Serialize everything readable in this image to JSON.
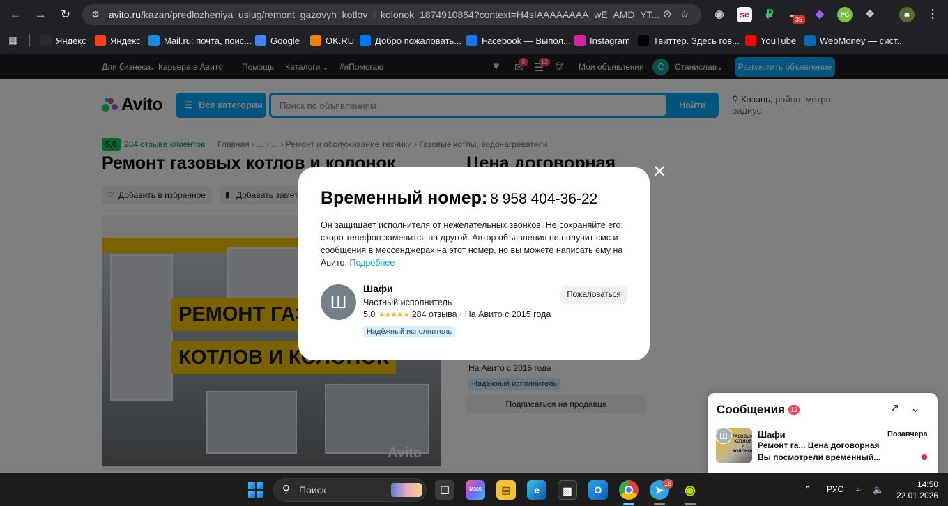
{
  "browser": {
    "url_host": "avito.ru",
    "url_path": "/kazan/predlozheniya_uslug/remont_gazovyh_kotlov_i_kolonok_1874910854?context=H4sIAAAAAAAA_wE_AMD_YT...",
    "extension_badge": "35",
    "bookmarks": [
      {
        "label": "Яндекс",
        "icon": "yandex-star-icon",
        "color": "#2b2b2b"
      },
      {
        "label": "Яндекс",
        "icon": "yandex-icon",
        "color": "#fc3f1d"
      },
      {
        "label": "Mail.ru: почта, поис...",
        "icon": "mailru-icon",
        "color": "#168de2"
      },
      {
        "label": "Google",
        "icon": "google-icon",
        "color": "#4285f4"
      },
      {
        "label": "OK.RU",
        "icon": "ok-icon",
        "color": "#ee8208"
      },
      {
        "label": "Добро пожаловать...",
        "icon": "vk-icon",
        "color": "#0077ff"
      },
      {
        "label": "Facebook — Выпол...",
        "icon": "facebook-icon",
        "color": "#1877f2"
      },
      {
        "label": "Instagram",
        "icon": "instagram-icon",
        "color": "#d6249f"
      },
      {
        "label": "Твиттер. Здесь гов...",
        "icon": "x-icon",
        "color": "#000000"
      },
      {
        "label": "YouTube",
        "icon": "youtube-icon",
        "color": "#ff0000"
      },
      {
        "label": "WebMoney — сист...",
        "icon": "webmoney-icon",
        "color": "#036cb5"
      }
    ]
  },
  "avito": {
    "topnav": {
      "business": "Для бизнеса",
      "career": "Карьера в Авито",
      "help": "Помощь",
      "catalogs": "Каталоги",
      "ihelp": "#яПомогаю",
      "notif_badge": "8",
      "chat_badge": "12",
      "my_ads": "Мои объявления",
      "user_initial": "С",
      "user_name": "Станислав",
      "post_ad": "Разместить объявление"
    },
    "logo_text": "Avito",
    "all_categories": "Все категории",
    "search_placeholder": "Поиск по объявлениям",
    "search_button": "Найти",
    "location_city": "Казань,",
    "location_rest": " район, метро, радиус",
    "rating": "5,0",
    "reviews_link": "284 отзыва клиентов",
    "breadcrumbs": "Главная  ›  ...  ›  ...  ›  Ремонт и обслуживание техники  ›  Газовые котлы, водонагреватели",
    "title": "Ремонт газовых котлов и колонок",
    "price": "Цена договорная",
    "add_favorite": "Добавить в избранное",
    "add_note": "Добавить заметку",
    "photo_banner_1": "РЕМОНТ ГАЗОВЫХ",
    "photo_banner_2": "КОТЛОВ И КОЛОНОК",
    "watermark": "Avito",
    "seller_since": "На Авито с 2015 года",
    "reliable_badge": "Надёжный исполнитель",
    "subscribe": "Подписаться на продавца"
  },
  "modal": {
    "label": "Временный номер:",
    "phone": "8 958 404-36-22",
    "description": "Он защищает исполнителя от нежелательных звонков. Не сохраняйте его: скоро телефон заменится на другой. Автор объявления не получит смс и сообщения в мессенджерах на этот номер, но вы можете написать ему на Авито.",
    "more_link": "Подробнее",
    "seller_initial": "Ш",
    "seller_name": "Шафи",
    "seller_role": "Частный исполнитель",
    "seller_rating": "5,0",
    "seller_reviews": "284 отзыва · На Авито с 2015 года",
    "reliable_badge": "Надёжный исполнитель",
    "complain": "Пожаловаться"
  },
  "messages": {
    "title": "Сообщения",
    "count": "12",
    "item": {
      "initial": "Ш",
      "name": "Шафи",
      "date": "Позавчера",
      "line1": "Ремонт га...  Цена договорная",
      "line2": "Вы посмотрели временный...",
      "thumb_text": "ГАЗОВЫХ КОТЛОВ И КОЛОНОК"
    }
  },
  "taskbar": {
    "search_label": "Поиск",
    "telegram_badge": "16",
    "language": "РУС",
    "time": "14:50",
    "date": "22.01.2026"
  }
}
